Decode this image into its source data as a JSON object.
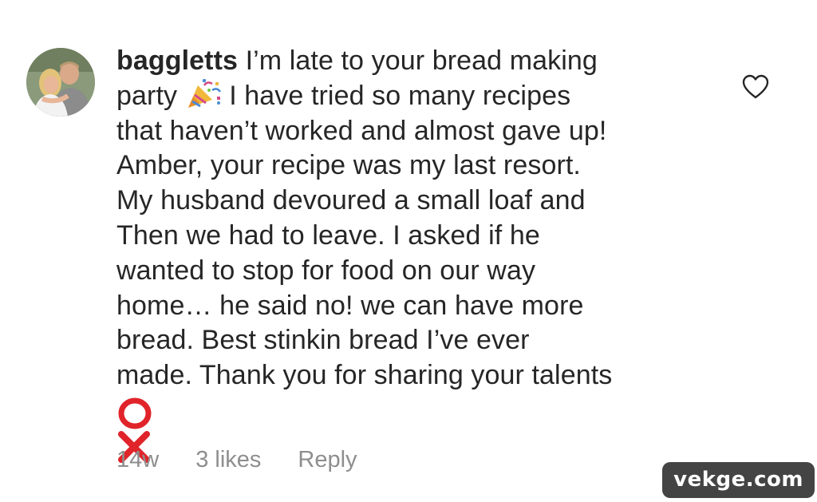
{
  "comment": {
    "username": "baggletts",
    "lines": [
      "I’m late to your bread making",
      "party",
      "I have tried so many recipes",
      "that haven’t worked and almost gave up!",
      "Amber, your recipe was my last resort.",
      "My husband devoured a small loaf and",
      "Then we had to leave. I asked if he",
      "wanted to stop for food on our way",
      "home… he said no!  we can have more",
      "bread.  Best stinkin bread I’ve ever",
      "made. Thank you for sharing your talents"
    ]
  },
  "meta": {
    "age": "14w",
    "likes": "3 likes",
    "reply": "Reply"
  },
  "icons": {
    "avatar": "avatar-photo",
    "like": "heart-outline-icon",
    "emoji_party": "party-popper-icon",
    "emoji_ox": "hugs-and-kisses-o-x-icon"
  },
  "colors": {
    "text": "#262626",
    "secondary": "#8e8e8e",
    "ox_red": "#e0242a"
  },
  "watermark": "vekge.com"
}
